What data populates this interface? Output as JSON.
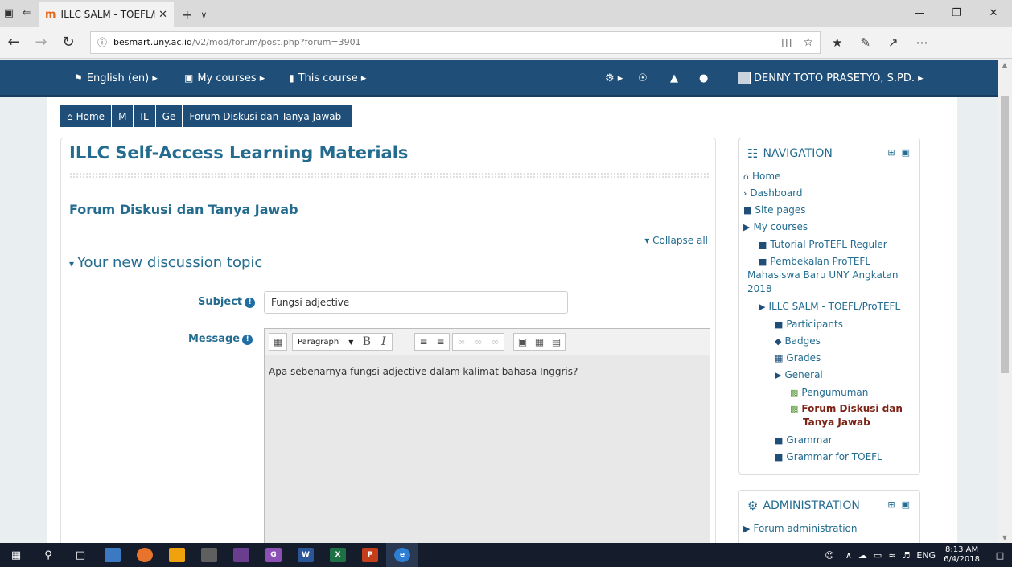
{
  "browser": {
    "tab_title": "ILLC SALM - TOEFL/Pro",
    "tab_favicon": "m",
    "url_domain": "besmart.uny.ac.id",
    "url_path": "/v2/mod/forum/post.php?forum=3901"
  },
  "navbar": {
    "language": "English (en) ▸",
    "my_courses": "My courses ▸",
    "this_course": "This course ▸",
    "user_name": "DENNY TOTO PRASETYO, S.PD. ▸"
  },
  "breadcrumb": {
    "home": "Home",
    "c1": "M",
    "c2": "IL",
    "c3": "Ge",
    "current": "Forum Diskusi dan Tanya Jawab"
  },
  "main": {
    "site_title": "ILLC Self-Access Learning Materials",
    "forum_title": "Forum Diskusi dan Tanya Jawab",
    "collapse_all": "Collapse all",
    "section_title": "Your new discussion topic",
    "subject_label": "Subject",
    "subject_value": "Fungsi adjective",
    "message_label": "Message",
    "paragraph_select": "Paragraph",
    "message_text": "Apa sebenarnya fungsi adjective dalam kalimat bahasa Inggris?"
  },
  "navigation_block": {
    "title": "NAVIGATION",
    "items": {
      "home": "Home",
      "dashboard": "Dashboard",
      "site_pages": "Site pages",
      "my_courses": "My courses",
      "tutorial": "Tutorial ProTEFL Reguler",
      "pembekalan_1": "Pembekalan ProTEFL",
      "pembekalan_2": "Mahasiswa Baru UNY Angkatan",
      "pembekalan_3": "2018",
      "illc": "ILLC SALM - TOEFL/ProTEFL",
      "participants": "Participants",
      "badges": "Badges",
      "grades": "Grades",
      "general": "General",
      "pengumuman": "Pengumuman",
      "forum_1": "Forum Diskusi dan",
      "forum_2": "Tanya Jawab",
      "grammar": "Grammar",
      "grammar_toefl": "Grammar for TOEFL"
    }
  },
  "admin_block": {
    "title": "ADMINISTRATION",
    "forum_admin": "Forum administration"
  },
  "taskbar": {
    "time": "8:13 AM",
    "date": "6/4/2018",
    "lang": "ENG"
  }
}
